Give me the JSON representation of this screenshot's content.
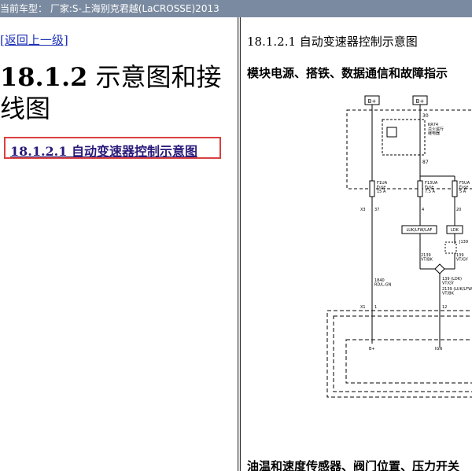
{
  "window": {
    "title": "当前车型：  厂家:S-上海别克君越(LaCROSSE)2013"
  },
  "left_pane": {
    "back_link": "[返回上一级]",
    "section_number": "18.1.2",
    "section_title": " 示意图和接线图",
    "toc_link": "18.1.2.1 自动变速器控制示意图"
  },
  "right_pane": {
    "heading": "18.1.2.1 自动变速器控制示意图",
    "subheading": "模块电源、搭铁、数据通信和故障指示",
    "bottom_heading": "油温和速度传感器、阀门位置、压力开关",
    "diagram": {
      "bplus_left": "B+",
      "bplus_right": "B+",
      "relay_pin_top": "30",
      "relay_pin_bottom": "87",
      "relay_label": "KR74\n点火运行\n继电器",
      "fuse1": "F1UA\nFuse\n15 A",
      "fuse2": "F13UA\nFuse\n7.5 A",
      "fuse3": "F5UA\nFuse\n5 A",
      "x3": "X3",
      "pin37": "37",
      "pin4": "4",
      "pin20": "20",
      "splice1": "LUK/LFW/LAF",
      "splice2": "LDK",
      "j139": "J139",
      "wire2139a": "2139\nVT/BK",
      "wire139": "139\nVT/GY",
      "wire1840": "1840\nRD/L-GN",
      "wire139ldk": "139 (LDK)\nVT/GY",
      "wire2139b": "2139 (LUK/LFW\nVT/BK",
      "x1": "X1",
      "pin1": "1",
      "pin12": "12",
      "bplus_bottom": "B+",
      "ign": "IGN"
    }
  }
}
